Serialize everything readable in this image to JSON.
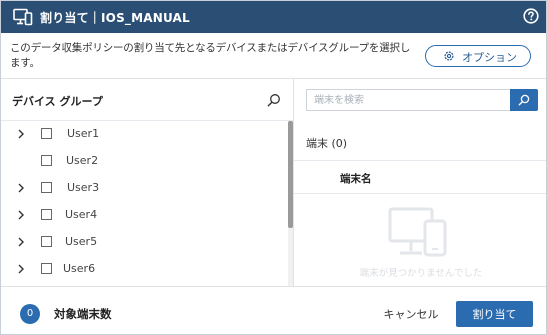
{
  "titlebar": {
    "title": "割り当て｜IOS_MANUAL",
    "app_icon": "devices-icon",
    "help_icon": "help-circle-icon"
  },
  "description": "このデータ収集ポリシーの割り当て先となるデバイスまたはデバイスグループを選択します。",
  "options_button": {
    "label": "オプション",
    "icon": "gear-icon"
  },
  "device_groups": {
    "heading": "デバイス グループ",
    "search_icon": "search-icon",
    "items": [
      {
        "label": "User1",
        "expandable": true
      },
      {
        "label": "User2",
        "expandable": false
      },
      {
        "label": "User3",
        "expandable": true
      },
      {
        "label": "User4",
        "expandable": true
      },
      {
        "label": "User5",
        "expandable": true
      },
      {
        "label": "User6",
        "expandable": true
      }
    ]
  },
  "devices": {
    "search_placeholder": "端末を検索",
    "count_label": "端末 (0)",
    "column_header": "端末名",
    "empty_message": "端末が見つかりませんでした",
    "empty_icon": "devices-icon"
  },
  "footer": {
    "count": "0",
    "count_label": "対象端末数",
    "cancel_label": "キャンセル",
    "assign_label": "割り当て"
  },
  "colors": {
    "header_bg": "#2b4e74",
    "accent": "#2b6cb0"
  }
}
